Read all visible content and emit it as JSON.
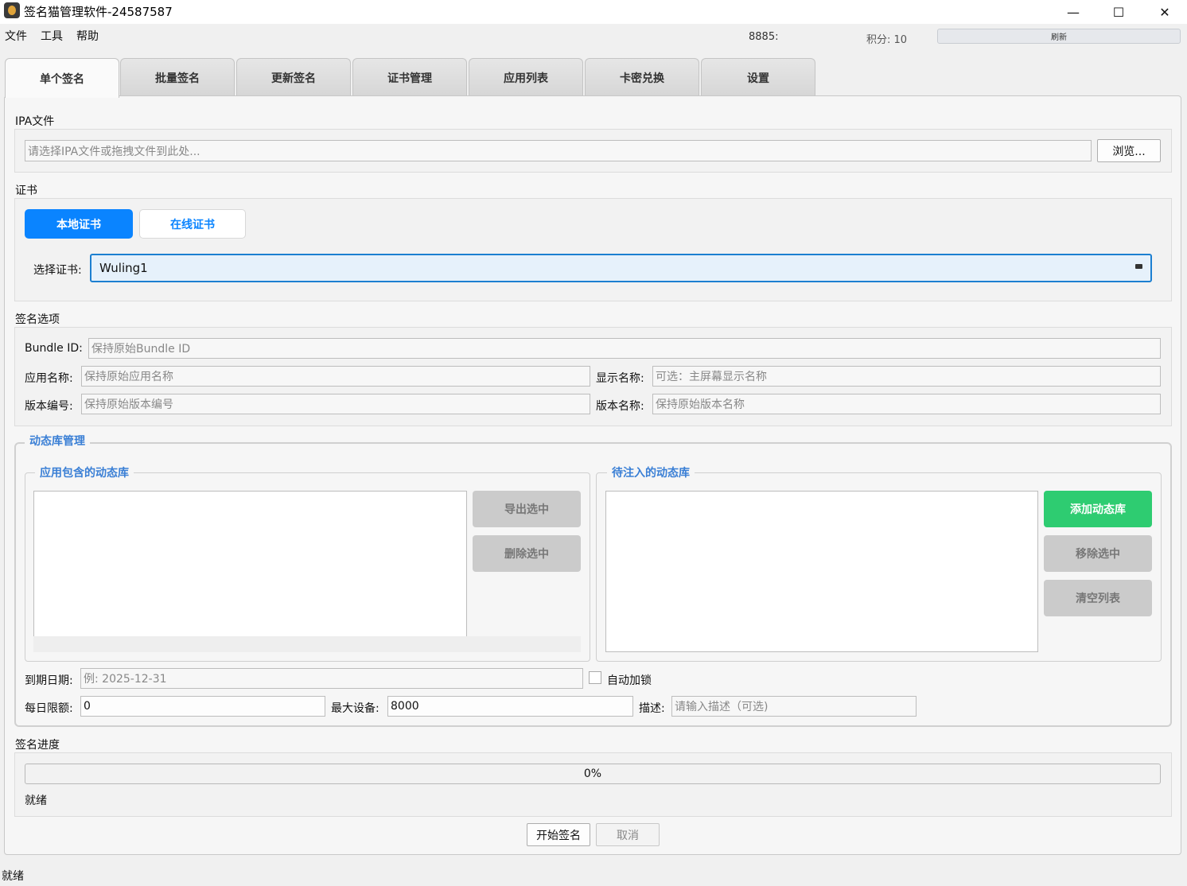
{
  "window": {
    "title": "签名猫管理软件-24587587",
    "minimize": "—",
    "maximize": "☐",
    "close": "✕"
  },
  "menu": {
    "items": [
      "文件",
      "工具",
      "帮助"
    ],
    "device_id": "8885:",
    "points": "积分: 10",
    "refresh": "刷新"
  },
  "tabs": [
    "单个签名",
    "批量签名",
    "更新签名",
    "证书管理",
    "应用列表",
    "卡密兑换",
    "设置"
  ],
  "active_tab": 0,
  "ipa": {
    "label": "IPA文件",
    "placeholder": "请选择IPA文件或拖拽文件到此处...",
    "browse": "浏览..."
  },
  "cert": {
    "label": "证书",
    "local": "本地证书",
    "online": "在线证书",
    "select_label": "选择证书:",
    "selected": "Wuling1"
  },
  "options": {
    "label": "签名选项",
    "bundle_id_label": "Bundle ID:",
    "bundle_id_placeholder": "保持原始Bundle ID",
    "app_name_label": "应用名称:",
    "app_name_placeholder": "保持原始应用名称",
    "display_name_label": "显示名称:",
    "display_name_placeholder": "可选：主屏幕显示名称",
    "version_code_label": "版本编号:",
    "version_code_placeholder": "保持原始版本编号",
    "version_name_label": "版本名称:",
    "version_name_placeholder": "保持原始版本名称"
  },
  "dylib": {
    "title": "动态库管理",
    "included_title": "应用包含的动态库",
    "export": "导出选中",
    "delete": "删除选中",
    "inject_title": "待注入的动态库",
    "add": "添加动态库",
    "remove": "移除选中",
    "clear": "清空列表",
    "expiry_label": "到期日期:",
    "expiry_placeholder": "例: 2025-12-31",
    "auto_lock": "自动加锁",
    "daily_limit_label": "每日限额:",
    "daily_limit": "0",
    "max_devices_label": "最大设备:",
    "max_devices": "8000",
    "desc_label": "描述:",
    "desc_placeholder": "请输入描述（可选)"
  },
  "progress": {
    "label": "签名进度",
    "percent": "0%",
    "value": 0,
    "status": "就绪"
  },
  "actions": {
    "start": "开始签名",
    "cancel": "取消"
  },
  "statusbar": "就绪",
  "colors": {
    "accent_blue": "#0a84ff",
    "green": "#2ecc71",
    "frame_title": "#3a7fd5"
  }
}
